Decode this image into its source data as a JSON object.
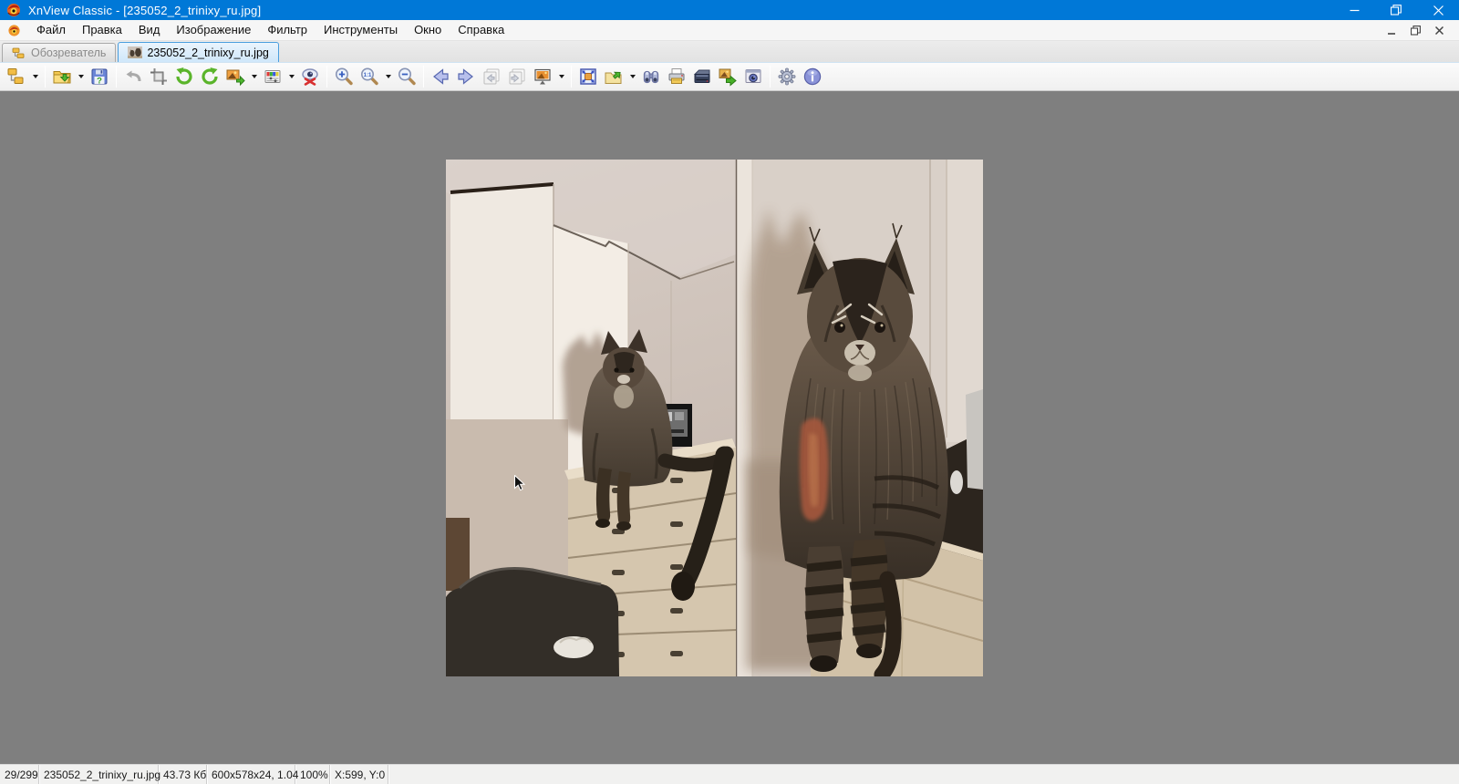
{
  "window": {
    "title": "XnView Classic - [235052_2_trinixy_ru.jpg]"
  },
  "menubar": {
    "items": [
      "Файл",
      "Правка",
      "Вид",
      "Изображение",
      "Фильтр",
      "Инструменты",
      "Окно",
      "Справка"
    ]
  },
  "tabbar": {
    "tabs": [
      {
        "label": "Обозреватель",
        "active": false
      },
      {
        "label": "235052_2_trinixy_ru.jpg",
        "active": true
      }
    ]
  },
  "toolbar": {
    "icons": [
      "browser-icon",
      "open-icon",
      "save-icon",
      "undo-icon",
      "crop-icon",
      "rotate-left-icon",
      "rotate-right-icon",
      "convert-icon",
      "adjust-colors-icon",
      "red-eye-icon",
      "zoom-in-icon",
      "zoom-1-1-icon",
      "zoom-out-icon",
      "previous-icon",
      "next-icon",
      "page-previous-icon",
      "page-next-icon",
      "slideshow-icon",
      "fullscreen-icon",
      "open-with-icon",
      "search-binoculars-icon",
      "print-icon",
      "scan-icon",
      "batch-convert-icon",
      "capture-icon",
      "settings-gear-icon",
      "info-icon"
    ]
  },
  "statusbar": {
    "cells": [
      "29/299",
      "235052_2_trinixy_ru.jpg",
      "43.73 Кб",
      "600x578x24, 1.04",
      "100%",
      "X:599, Y:0"
    ]
  },
  "image": {
    "filename": "235052_2_trinixy_ru.jpg",
    "description": "Photo of two long-haired Maine Coon cats sitting on light wooden dressers in a white bedroom, each casting a large ear-tufted shadow on the cream wall; a dark armchair sits lower left."
  },
  "colors": {
    "titlebar": "#0078d7",
    "canvas": "#7f7f7f",
    "tab_active_bg": "#cfe7fa",
    "tab_active_border": "#4a9ede",
    "statusbar_bg": "#f1f1f0"
  }
}
